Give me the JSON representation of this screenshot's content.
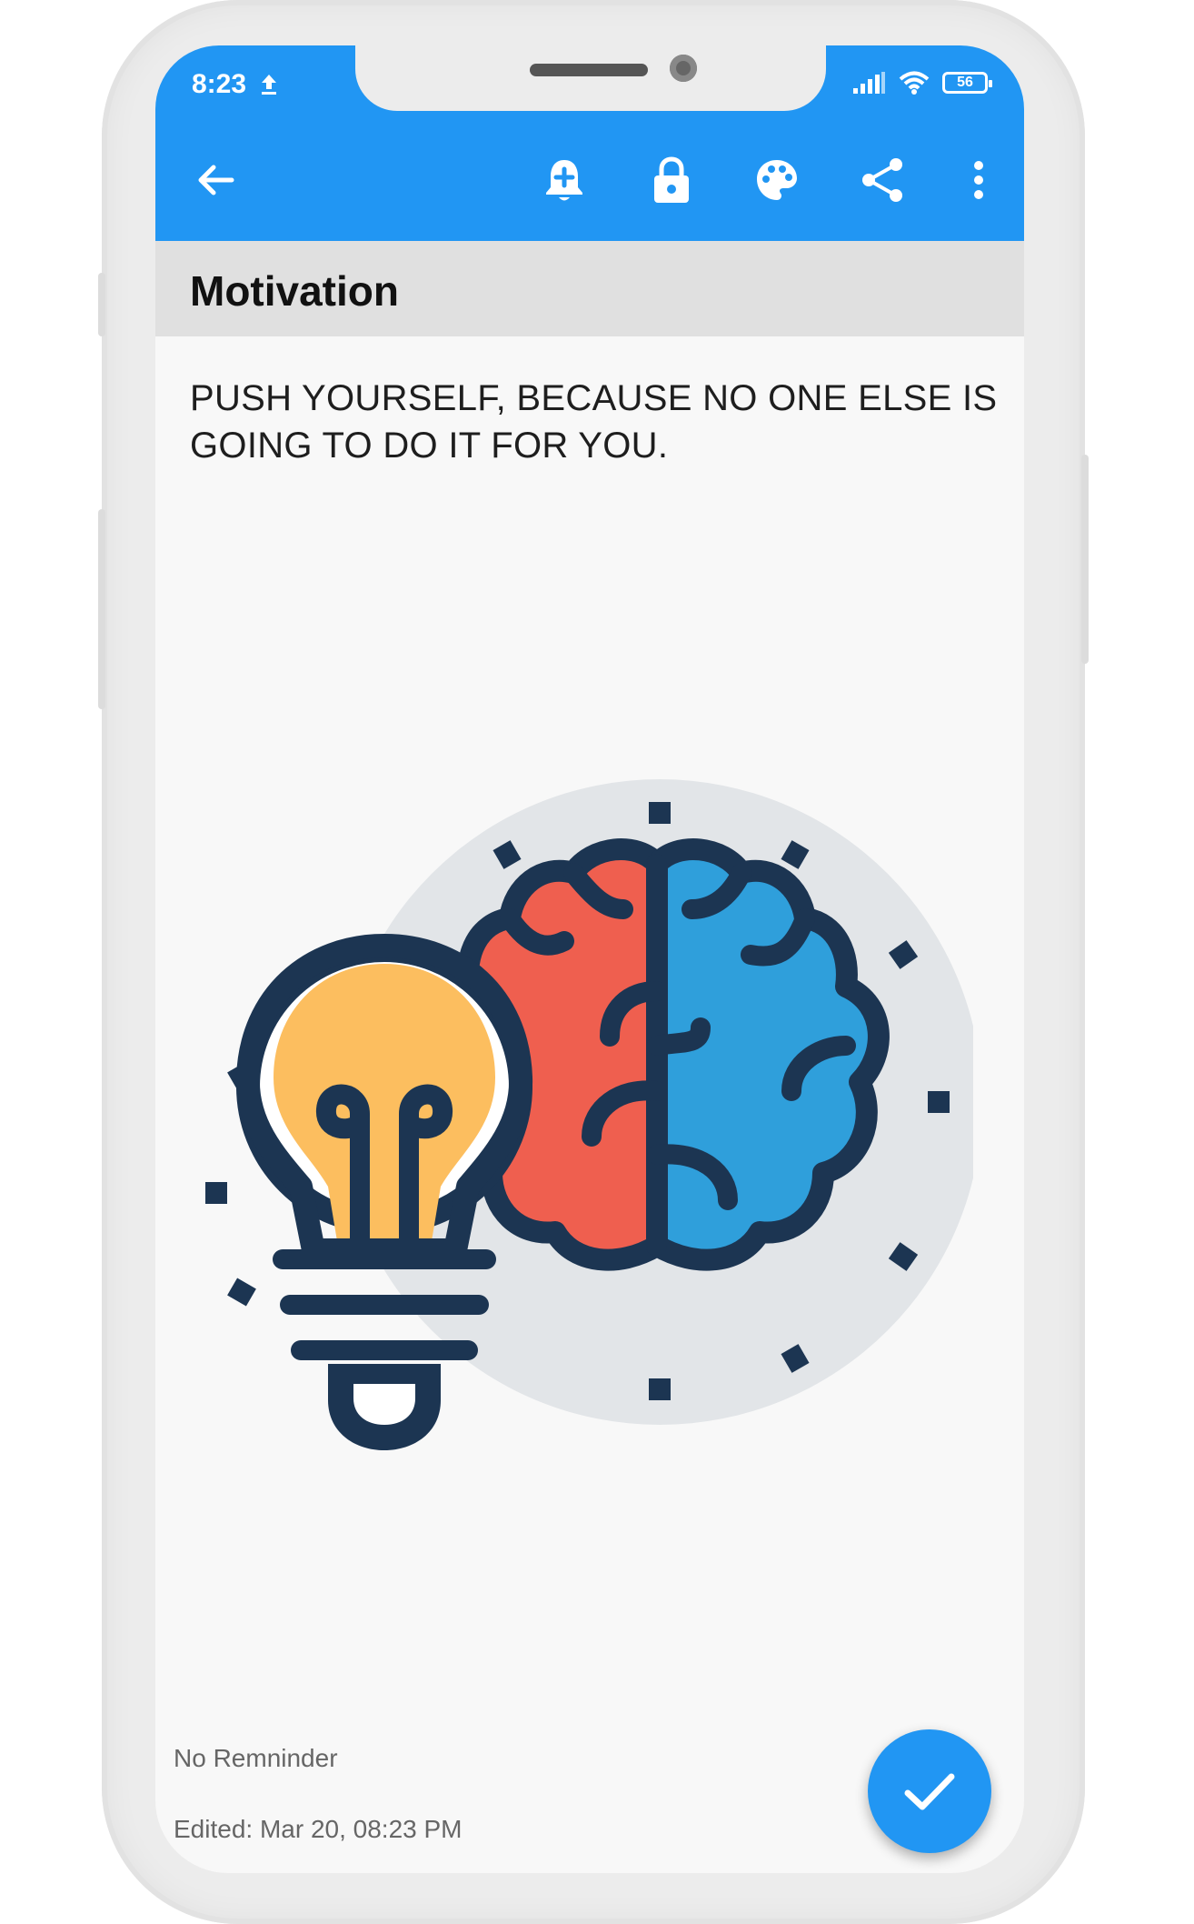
{
  "status_bar": {
    "time": "8:23",
    "battery": "56",
    "icons": [
      "upload-icon",
      "signal-icon",
      "wifi-icon",
      "battery-icon"
    ]
  },
  "app_bar": {
    "icons": [
      "back-arrow-icon",
      "add-reminder-bell-icon",
      "lock-icon",
      "palette-icon",
      "share-icon",
      "more-vert-icon"
    ],
    "color": "#2196f3"
  },
  "note": {
    "title": "Motivation",
    "body": "PUSH YOURSELF, BECAUSE NO ONE ELSE IS GOING TO DO IT FOR YOU.",
    "image": "lightbulb-brain-illustration"
  },
  "footer": {
    "reminder": "No Remninder",
    "edited": "Edited: Mar 20, 08:23 PM"
  },
  "fab": {
    "icon": "checkmark-icon",
    "color": "#2196f3"
  }
}
